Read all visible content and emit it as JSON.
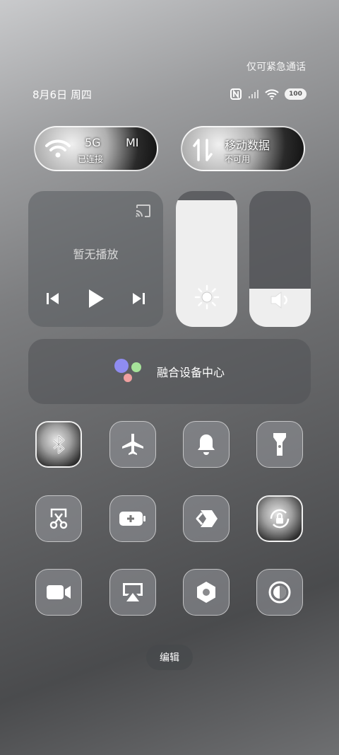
{
  "status": {
    "emergency_text": "仅可紧急通话",
    "date_text": "8月6日 周四",
    "battery": "100"
  },
  "pills": {
    "wifi": {
      "title": "5G",
      "extra": "MI",
      "subtitle": "已连接"
    },
    "data": {
      "title": "移动数据",
      "subtitle": "不可用"
    }
  },
  "media": {
    "empty_text": "暂无播放"
  },
  "sliders": {
    "brightness_level": 0.93,
    "volume_level": 0.28
  },
  "fusion": {
    "label": "融合设备中心",
    "colors": [
      "#8f8cf0",
      "#a6e39a",
      "#f0a0a0"
    ]
  },
  "tiles": [
    {
      "name": "bluetooth",
      "icon": "bluetooth-icon",
      "active": true
    },
    {
      "name": "airplane",
      "icon": "airplane-icon",
      "active": false
    },
    {
      "name": "sound",
      "icon": "bell-icon",
      "active": false
    },
    {
      "name": "flashlight",
      "icon": "flashlight-icon",
      "active": false
    },
    {
      "name": "screenshot",
      "icon": "scissors-icon",
      "active": false
    },
    {
      "name": "power-saving",
      "icon": "battery-plus-icon",
      "active": false
    },
    {
      "name": "share",
      "icon": "share-icon",
      "active": false
    },
    {
      "name": "rotation-lock",
      "icon": "rotation-lock-icon",
      "active": true
    },
    {
      "name": "screen-record",
      "icon": "video-camera-icon",
      "active": false
    },
    {
      "name": "screen-cast",
      "icon": "airplay-icon",
      "active": false
    },
    {
      "name": "settings",
      "icon": "hexagon-settings-icon",
      "active": false
    },
    {
      "name": "dark-mode",
      "icon": "contrast-icon",
      "active": false
    }
  ],
  "edit_label": "编辑"
}
